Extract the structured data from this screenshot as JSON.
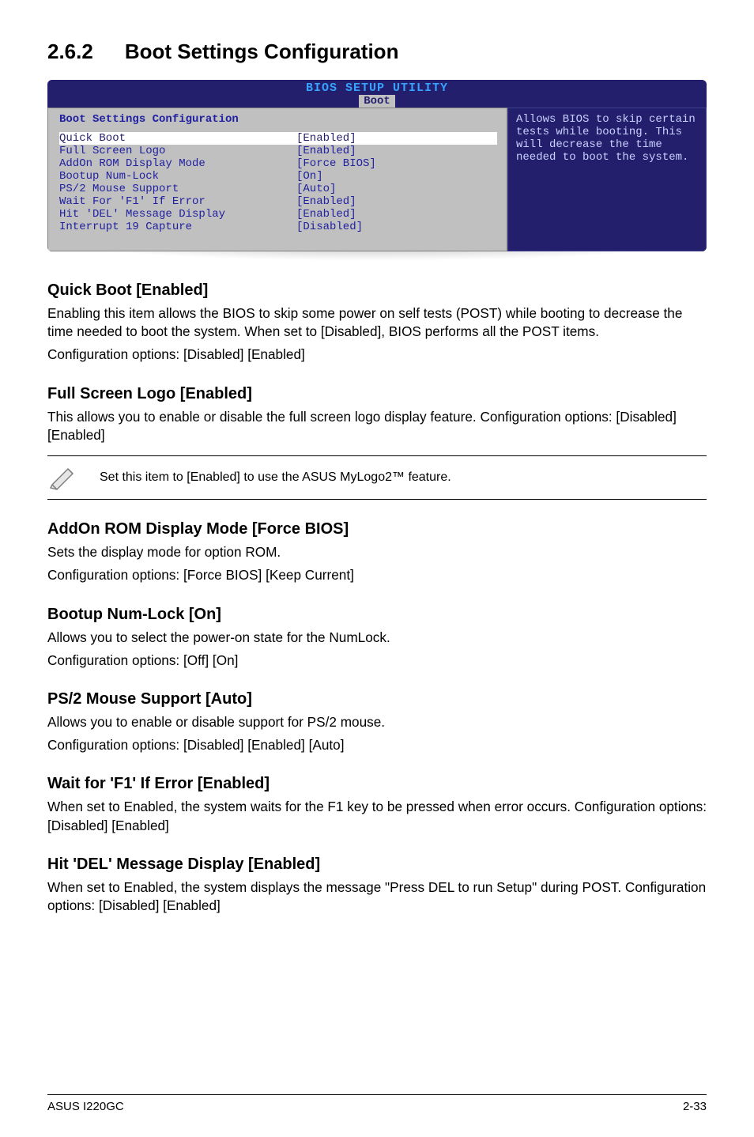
{
  "section": {
    "number": "2.6.2",
    "title": "Boot Settings Configuration"
  },
  "bios": {
    "utility_title": "BIOS SETUP UTILITY",
    "tab": "Boot",
    "panel_heading": "Boot Settings Configuration",
    "rows": [
      {
        "label": "Quick Boot",
        "value": "[Enabled]",
        "highlight": true
      },
      {
        "label": "Full Screen Logo",
        "value": "[Enabled]"
      },
      {
        "label": "AddOn ROM Display Mode",
        "value": "[Force BIOS]"
      },
      {
        "label": "Bootup Num-Lock",
        "value": "[On]"
      },
      {
        "label": "PS/2 Mouse Support",
        "value": "[Auto]"
      },
      {
        "label": "Wait For 'F1' If Error",
        "value": "[Enabled]"
      },
      {
        "label": "Hit 'DEL' Message Display",
        "value": "[Enabled]"
      },
      {
        "label": "Interrupt 19 Capture",
        "value": "[Disabled]"
      }
    ],
    "help_text": "Allows BIOS to skip certain tests while booting. This will decrease the time needed to boot the system."
  },
  "settings": [
    {
      "heading": "Quick Boot [Enabled]",
      "paragraphs": [
        "Enabling this item allows the BIOS to skip some power on self tests (POST) while booting to decrease the time needed to boot the system. When set to [Disabled], BIOS performs all the POST items.",
        "Configuration options: [Disabled] [Enabled]"
      ]
    },
    {
      "heading": "Full Screen Logo [Enabled]",
      "paragraphs": [
        "This allows you to enable or disable the full screen logo display feature. Configuration options: [Disabled] [Enabled]"
      ],
      "note": "Set this item to [Enabled] to use the ASUS MyLogo2™ feature."
    },
    {
      "heading": "AddOn ROM Display Mode [Force BIOS]",
      "paragraphs": [
        "Sets the display mode for option ROM.",
        "Configuration options: [Force BIOS] [Keep Current]"
      ]
    },
    {
      "heading": "Bootup Num-Lock [On]",
      "paragraphs": [
        "Allows you to select the power-on state for the NumLock.",
        "Configuration options: [Off] [On]"
      ]
    },
    {
      "heading": "PS/2 Mouse Support [Auto]",
      "paragraphs": [
        "Allows you to enable or disable support for PS/2 mouse.",
        "Configuration options: [Disabled] [Enabled] [Auto]"
      ]
    },
    {
      "heading": "Wait for 'F1' If Error [Enabled]",
      "paragraphs": [
        "When set to Enabled, the system waits for the F1 key to be pressed when error occurs. Configuration options: [Disabled] [Enabled]"
      ]
    },
    {
      "heading": "Hit 'DEL' Message Display [Enabled]",
      "paragraphs": [
        "When set to Enabled, the system displays the message \"Press DEL to run Setup\" during POST. Configuration options: [Disabled] [Enabled]"
      ]
    }
  ],
  "footer": {
    "left": "ASUS I220GC",
    "right": "2-33"
  }
}
